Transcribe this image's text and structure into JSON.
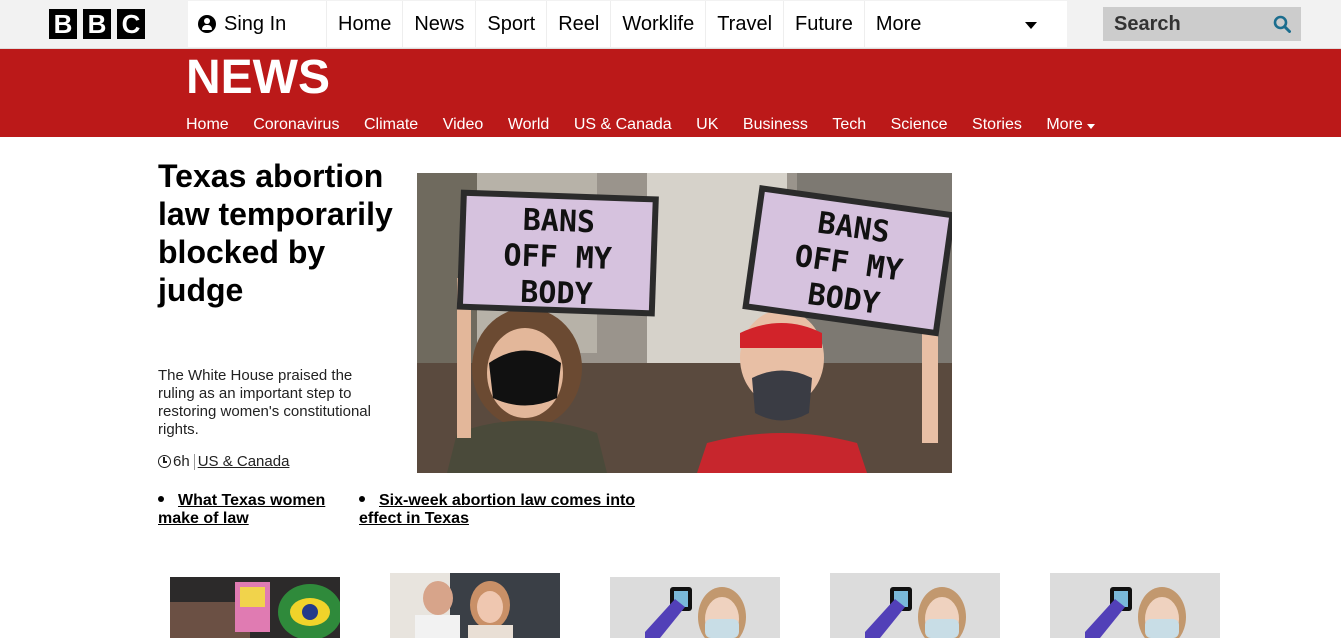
{
  "brand": {
    "letters": [
      "B",
      "B",
      "C"
    ]
  },
  "topnav": {
    "signin": "Sing In",
    "items": [
      "Home",
      "News",
      "Sport",
      "Reel",
      "Worklife",
      "Travel",
      "Future",
      "More"
    ]
  },
  "search": {
    "label": "Search"
  },
  "section": {
    "title": "NEWS",
    "nav": [
      "Home",
      "Coronavirus",
      "Climate",
      "Video",
      "World",
      "US & Canada",
      "UK",
      "Business",
      "Tech",
      "Science",
      "Stories",
      "More"
    ]
  },
  "main_story": {
    "headline": "Texas abortion law temporarily blocked by judge",
    "summary": "The White House praised the ruling as an important step to restoring women's constitutional rights.",
    "time": "6h",
    "category": "US & Canada",
    "image": {
      "sign_text": [
        "BANS",
        "OFF MY",
        "BODY"
      ]
    }
  },
  "related": [
    "What Texas women make of law",
    "Six-week abortion law comes into effect in Texas"
  ],
  "colors": {
    "brand_red": "#bb1919",
    "search_icon": "#1b6d8e"
  }
}
